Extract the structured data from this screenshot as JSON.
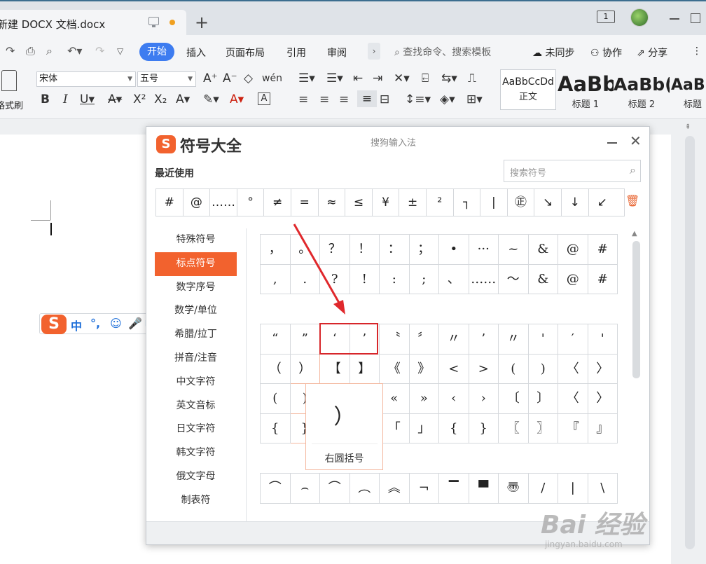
{
  "titlebar": {
    "doc_title": "新建 DOCX 文档.docx",
    "new_tab": "+",
    "badge": "1"
  },
  "menu": {
    "start": "开始",
    "items": [
      "插入",
      "页面布局",
      "引用",
      "审阅"
    ],
    "more": "›",
    "search_placeholder": "查找命令、搜索模板",
    "right": [
      "未同步",
      "协作",
      "分享"
    ]
  },
  "ribbon": {
    "format_painter": "格式刷",
    "font": "宋体",
    "size": "五号",
    "styles": [
      {
        "preview": "AaBbCcDd",
        "name": "正文"
      },
      {
        "preview": "AaBb",
        "name": "标题 1"
      },
      {
        "preview": "AaBb(",
        "name": "标题 2"
      },
      {
        "preview": "AaBl",
        "name": "标题"
      }
    ]
  },
  "ime": {
    "logo": "S",
    "lang": "中",
    "punct": "°,",
    "icons": [
      "smile-icon",
      "mic-icon",
      "keyboard-icon",
      "user-icon",
      "shirt-icon",
      "grid-icon"
    ]
  },
  "dialog": {
    "logo": "S",
    "title": "符号大全",
    "subtitle": "搜狗输入法",
    "recent_label": "最近使用",
    "search_placeholder": "搜索符号",
    "recent": [
      "#",
      "@",
      "……",
      "°",
      "≠",
      "=",
      "≈",
      "≤",
      "¥",
      "±",
      "²",
      "┐",
      "|",
      "㊣",
      "↘",
      "↓",
      "↙"
    ],
    "categories": [
      "特殊符号",
      "标点符号",
      "数字序号",
      "数学/单位",
      "希腊/拉丁",
      "拼音/注音",
      "中文字符",
      "英文音标",
      "日文字符",
      "韩文字符",
      "俄文字母",
      "制表符"
    ],
    "active_category": "标点符号",
    "grid1": [
      "，",
      "。",
      "？",
      "！",
      "：",
      "；",
      "•",
      "···",
      "~",
      "&",
      "@",
      "#",
      ",",
      ".",
      "?",
      "!",
      ":",
      ";",
      "、",
      "……",
      "～",
      "&",
      "@",
      "#"
    ],
    "grid2": [
      "“",
      "”",
      "‘",
      "’",
      "〝",
      "〞",
      "〃",
      "’",
      "〃",
      "'",
      "′",
      "'",
      "（",
      "）",
      "【",
      "】",
      "《",
      "》",
      "<",
      ">",
      "(",
      ")",
      "〈",
      "〉",
      "(",
      ")",
      "",
      "",
      "«",
      "»",
      "‹",
      "›",
      "〔",
      "〕",
      "〈",
      "〉",
      "{",
      "}",
      "",
      "",
      "「",
      "」",
      "{",
      "}",
      "〖",
      "〗",
      "『",
      "』"
    ],
    "grid3": [
      "⌒",
      "⌢",
      "⌒",
      "︵",
      "︽",
      "¬",
      "▔",
      "▀",
      "〠",
      "/",
      "|",
      "\\"
    ],
    "preview_symbol": "）",
    "preview_name": "右圆括号"
  },
  "watermark": {
    "brand": "Bai 经验",
    "url": "jingyan.baidu.com"
  }
}
